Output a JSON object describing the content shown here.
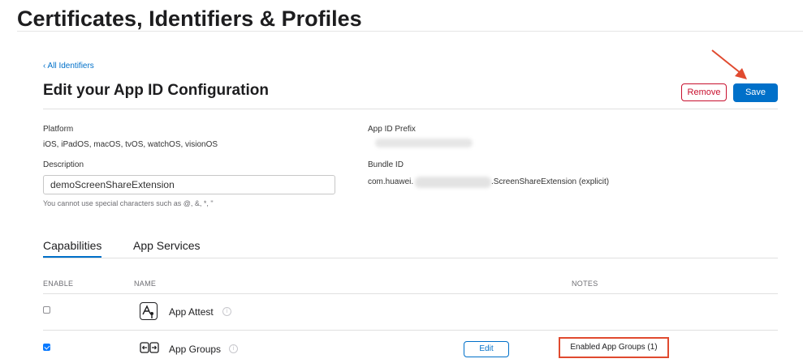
{
  "header": {
    "title": "Certificates, Identifiers & Profiles"
  },
  "nav": {
    "back_link": "‹ All Identifiers"
  },
  "page": {
    "title": "Edit your App ID Configuration",
    "remove_label": "Remove",
    "save_label": "Save"
  },
  "details": {
    "platform_label": "Platform",
    "platform_value": "iOS, iPadOS, macOS, tvOS, watchOS, visionOS",
    "app_id_prefix_label": "App ID Prefix",
    "description_label": "Description",
    "description_value": "demoScreenShareExtension",
    "description_hint": "You cannot use special characters such as @, &, *, \"",
    "bundle_id_label": "Bundle ID",
    "bundle_id_prefix": "com.huawei.",
    "bundle_id_suffix": ".ScreenShareExtension (explicit)"
  },
  "tabs": [
    {
      "label": "Capabilities",
      "active": true
    },
    {
      "label": "App Services",
      "active": false
    }
  ],
  "table": {
    "columns": {
      "enable": "ENABLE",
      "name": "NAME",
      "notes": "NOTES"
    },
    "rows": [
      {
        "name": "App Attest",
        "enabled": false,
        "icon": "app-attest-icon"
      },
      {
        "name": "App Groups",
        "enabled": true,
        "icon": "app-groups-icon",
        "action_label": "Edit",
        "note": "Enabled App Groups (1)"
      }
    ]
  },
  "colors": {
    "accent": "#0070c9",
    "danger": "#c8102e",
    "annotation": "#e04a2f"
  }
}
